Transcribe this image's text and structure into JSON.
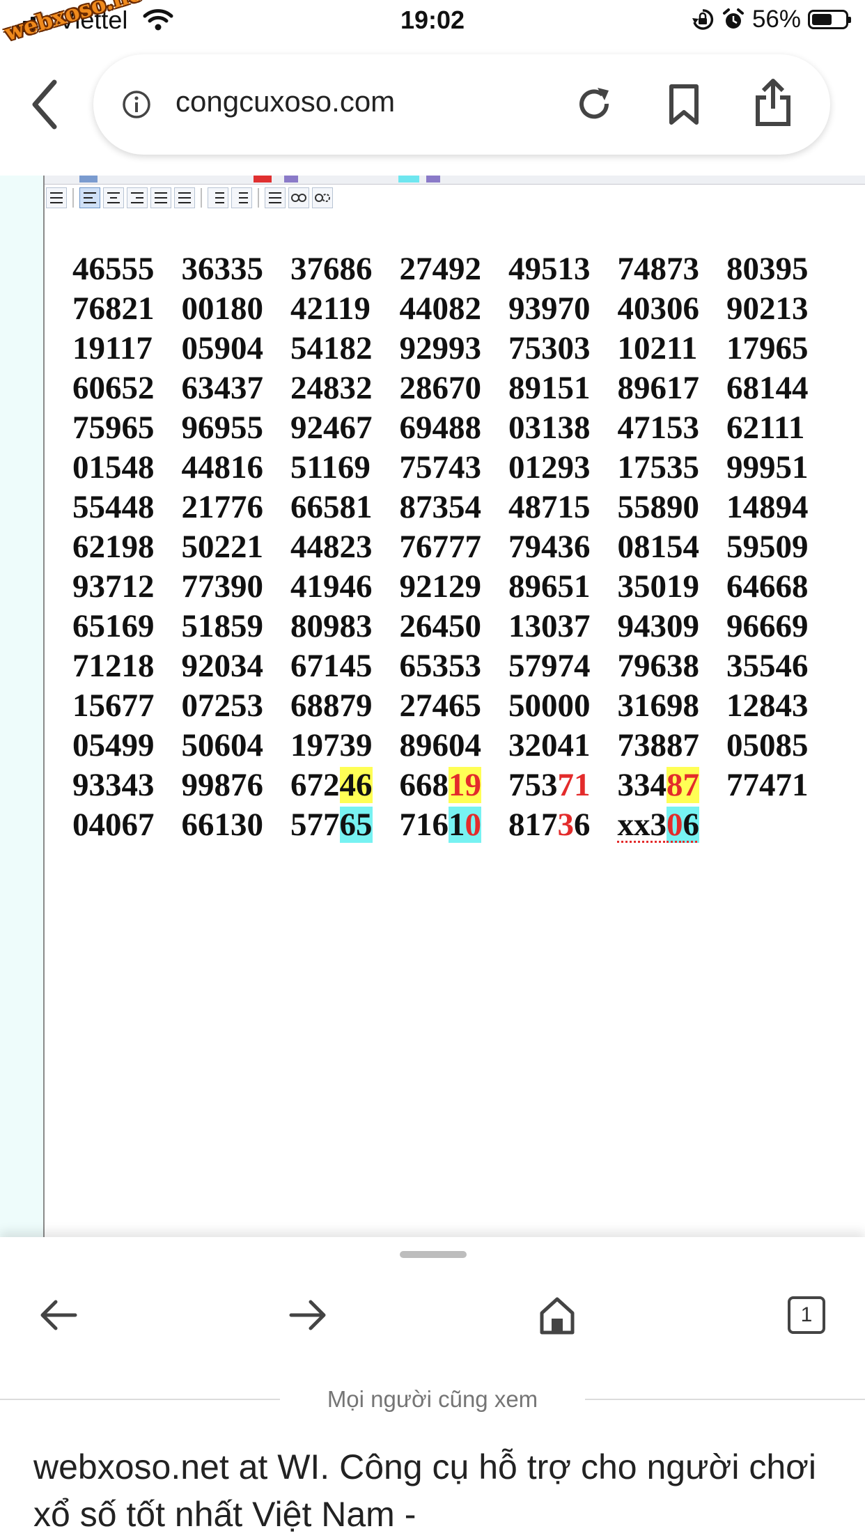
{
  "status_bar": {
    "carrier": "Viettel",
    "watermark": "webxoso.net",
    "time": "19:02",
    "battery": "56%",
    "battery_level": 0.56
  },
  "browser": {
    "url": "congcuxoso.com"
  },
  "numbers": {
    "rows": [
      [
        [
          "46555"
        ],
        [
          "36335"
        ],
        [
          "37686"
        ],
        [
          "27492"
        ],
        [
          "49513"
        ],
        [
          "74873"
        ],
        [
          "80395"
        ]
      ],
      [
        [
          "76821"
        ],
        [
          "00180"
        ],
        [
          "42119"
        ],
        [
          "44082"
        ],
        [
          "93970"
        ],
        [
          "40306"
        ],
        [
          "90213"
        ]
      ],
      [
        [
          "19117"
        ],
        [
          "05904"
        ],
        [
          "54182"
        ],
        [
          "92993"
        ],
        [
          "75303"
        ],
        [
          "10211"
        ],
        [
          "17965"
        ]
      ],
      [
        [
          "60652"
        ],
        [
          "63437"
        ],
        [
          "24832"
        ],
        [
          "28670"
        ],
        [
          "89151"
        ],
        [
          "89617"
        ],
        [
          "68144"
        ]
      ],
      [
        [
          "75965"
        ],
        [
          "96955"
        ],
        [
          "92467"
        ],
        [
          "69488"
        ],
        [
          "03138"
        ],
        [
          "47153"
        ],
        [
          "62111"
        ]
      ],
      [
        [
          "01548"
        ],
        [
          "44816"
        ],
        [
          "51169"
        ],
        [
          "75743"
        ],
        [
          "01293"
        ],
        [
          "17535"
        ],
        [
          "99951"
        ]
      ],
      [
        [
          "55448"
        ],
        [
          "21776"
        ],
        [
          "66581"
        ],
        [
          "87354"
        ],
        [
          "48715"
        ],
        [
          "55890"
        ],
        [
          "14894"
        ]
      ],
      [
        [
          "62198"
        ],
        [
          "50221"
        ],
        [
          "44823"
        ],
        [
          "76777"
        ],
        [
          "79436"
        ],
        [
          "08154"
        ],
        [
          "59509"
        ]
      ],
      [
        [
          "93712"
        ],
        [
          "77390"
        ],
        [
          "41946"
        ],
        [
          "92129"
        ],
        [
          "89651"
        ],
        [
          "35019"
        ],
        [
          "64668"
        ]
      ],
      [
        [
          "65169"
        ],
        [
          "51859"
        ],
        [
          "80983"
        ],
        [
          "26450"
        ],
        [
          "13037"
        ],
        [
          "94309"
        ],
        [
          "96669"
        ]
      ],
      [
        [
          "71218"
        ],
        [
          "92034"
        ],
        [
          "67145"
        ],
        [
          "65353"
        ],
        [
          "57974"
        ],
        [
          "79638"
        ],
        [
          "35546"
        ]
      ],
      [
        [
          "15677"
        ],
        [
          "07253"
        ],
        [
          "68879"
        ],
        [
          "27465"
        ],
        [
          "50000"
        ],
        [
          "31698"
        ],
        [
          "12843"
        ]
      ],
      [
        [
          "05499"
        ],
        [
          "50604"
        ],
        [
          "19739"
        ],
        [
          "89604"
        ],
        [
          "32041"
        ],
        [
          "73887"
        ],
        [
          "05085"
        ]
      ],
      [
        [
          "93343"
        ],
        [
          "99876"
        ],
        [
          "672",
          "46|y"
        ],
        [
          "668",
          "19|yr"
        ],
        [
          "753",
          "71|r"
        ],
        [
          "334",
          "87|yr"
        ],
        [
          "77471"
        ]
      ],
      [
        [
          "04067"
        ],
        [
          "66130"
        ],
        [
          "577",
          "65|c"
        ],
        [
          "716",
          "1|c",
          "0|cr"
        ],
        [
          "817",
          "3|r",
          "6"
        ],
        [
          "xx3",
          "0|cr",
          "6|c"
        ]
      ]
    ]
  },
  "bottom_sheet": {
    "tabs_count": "1",
    "section_label": "Mọi người cũng xem",
    "suggestion_title": "webxoso.net at WI. Công cụ hỗ trợ cho người chơi xổ số tốt nhất Việt Nam -"
  }
}
